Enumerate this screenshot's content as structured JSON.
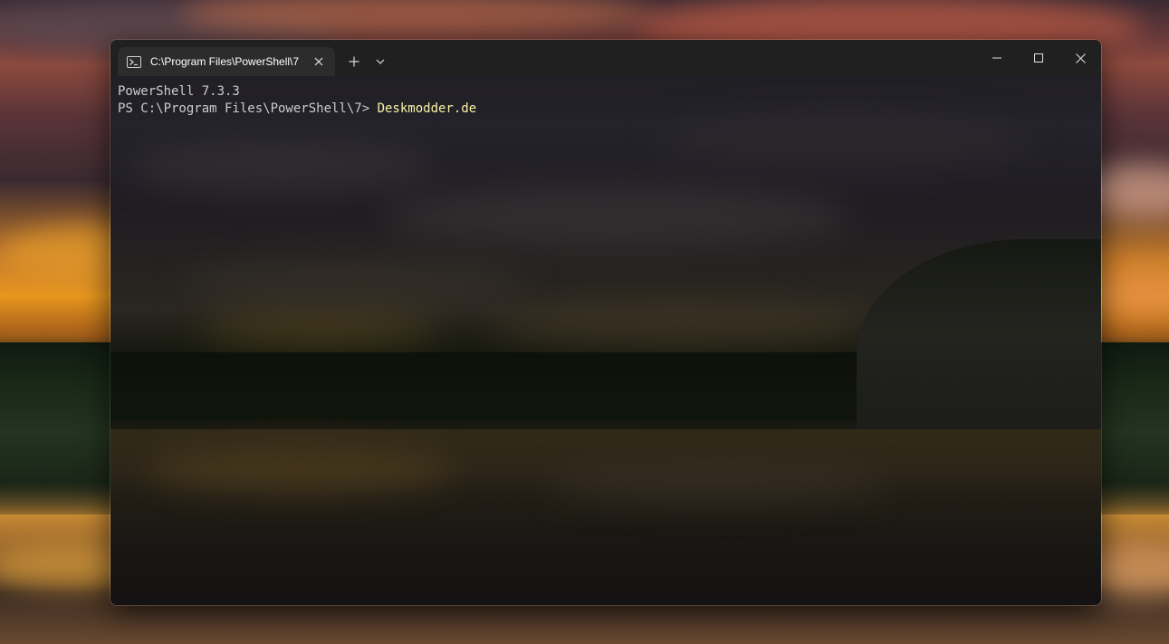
{
  "window": {
    "tab": {
      "title": "C:\\Program Files\\PowerShell\\7",
      "icon": "powershell-icon"
    },
    "buttons": {
      "new_tab_icon": "plus-icon",
      "dropdown_icon": "chevron-down-icon",
      "minimize_icon": "minimize-icon",
      "maximize_icon": "maximize-icon",
      "close_icon": "close-icon"
    }
  },
  "terminal": {
    "lines": [
      {
        "text": "PowerShell 7.3.3"
      },
      {
        "prompt": "PS C:\\Program Files\\PowerShell\\7> ",
        "command": "Deskmodder.de"
      }
    ]
  },
  "colors": {
    "foreground": "#cccccc",
    "command": "#f9f1a5",
    "titlebar": "#202020",
    "tab": "#2c2c2c"
  }
}
